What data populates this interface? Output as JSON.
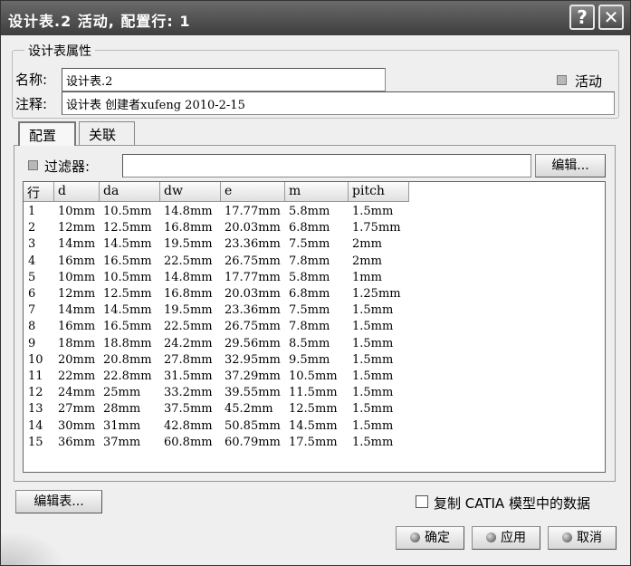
{
  "window": {
    "title": "设计表.2 活动, 配置行:  1",
    "help_label": "?",
    "close_label": "✕"
  },
  "properties": {
    "group_title": "设计表属性",
    "name_label": "名称:",
    "name_value": "设计表.2",
    "active_label": "活动",
    "comment_label": "注释:",
    "comment_value": "设计表 创建者xufeng 2010-2-15"
  },
  "tabs": [
    {
      "label": "配置",
      "active": true
    },
    {
      "label": "关联",
      "active": false
    }
  ],
  "filter": {
    "label": "过滤器:",
    "value": "",
    "edit_button": "编辑..."
  },
  "table": {
    "columns": [
      "行",
      "d",
      "da",
      "dw",
      "e",
      "m",
      "pitch"
    ],
    "rows": [
      [
        "1",
        "10mm",
        "10.5mm",
        "14.8mm",
        "17.77mm",
        "5.8mm",
        "1.5mm"
      ],
      [
        "2",
        "12mm",
        "12.5mm",
        "16.8mm",
        "20.03mm",
        "6.8mm",
        "1.75mm"
      ],
      [
        "3",
        "14mm",
        "14.5mm",
        "19.5mm",
        "23.36mm",
        "7.5mm",
        "2mm"
      ],
      [
        "4",
        "16mm",
        "16.5mm",
        "22.5mm",
        "26.75mm",
        "7.8mm",
        "2mm"
      ],
      [
        "5",
        "10mm",
        "10.5mm",
        "14.8mm",
        "17.77mm",
        "5.8mm",
        "1mm"
      ],
      [
        "6",
        "12mm",
        "12.5mm",
        "16.8mm",
        "20.03mm",
        "6.8mm",
        "1.25mm"
      ],
      [
        "7",
        "14mm",
        "14.5mm",
        "19.5mm",
        "23.36mm",
        "7.5mm",
        "1.5mm"
      ],
      [
        "8",
        "16mm",
        "16.5mm",
        "22.5mm",
        "26.75mm",
        "7.8mm",
        "1.5mm"
      ],
      [
        "9",
        "18mm",
        "18.8mm",
        "24.2mm",
        "29.56mm",
        "8.5mm",
        "1.5mm"
      ],
      [
        "10",
        "20mm",
        "20.8mm",
        "27.8mm",
        "32.95mm",
        "9.5mm",
        "1.5mm"
      ],
      [
        "11",
        "22mm",
        "22.8mm",
        "31.5mm",
        "37.29mm",
        "10.5mm",
        "1.5mm"
      ],
      [
        "12",
        "24mm",
        "25mm",
        "33.2mm",
        "39.55mm",
        "11.5mm",
        "1.5mm"
      ],
      [
        "13",
        "27mm",
        "28mm",
        "37.5mm",
        "45.2mm",
        "12.5mm",
        "1.5mm"
      ],
      [
        "14",
        "30mm",
        "31mm",
        "42.8mm",
        "50.85mm",
        "14.5mm",
        "1.5mm"
      ],
      [
        "15",
        "36mm",
        "37mm",
        "60.8mm",
        "60.79mm",
        "17.5mm",
        "1.5mm"
      ]
    ]
  },
  "footer": {
    "edit_table_button": "编辑表...",
    "copy_checkbox_label": "复制 CATIA 模型中的数据",
    "ok_button": "确定",
    "apply_button": "应用",
    "cancel_button": "取消"
  }
}
